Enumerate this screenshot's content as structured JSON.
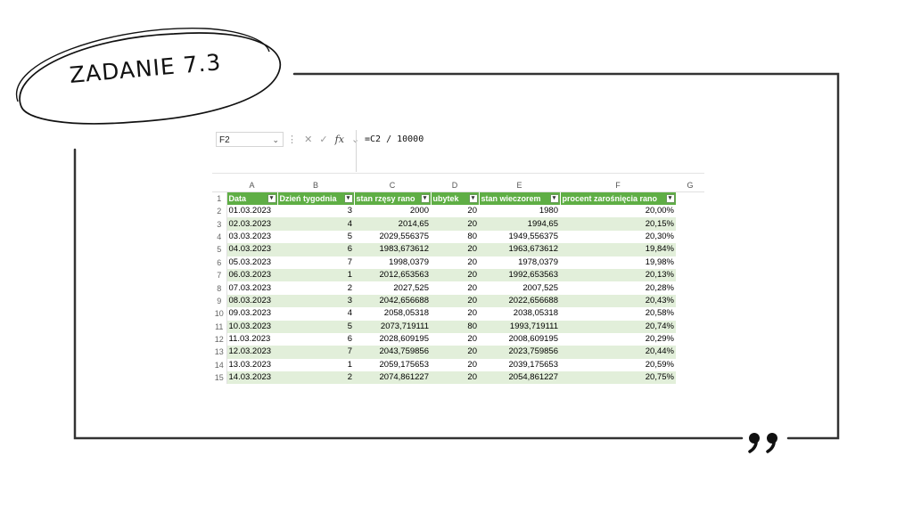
{
  "title": "ZADANIE 7.3",
  "colors": {
    "header_fill": "#5fae45",
    "band_fill": "#e2efda",
    "frame": "#333333"
  },
  "decoration": {
    "quote_icon": "closing-quote-icon",
    "glyph": "99"
  },
  "spreadsheet": {
    "name_box": "F2",
    "fx_label": "fx",
    "formula": "=C2 / 10000",
    "column_letters": [
      "A",
      "B",
      "C",
      "D",
      "E",
      "F",
      "G"
    ],
    "headers": [
      "Data",
      "Dzień tygodnia",
      "stan rzęsy rano",
      "ubytek",
      "stan wieczorem",
      "procent zarośnięcia rano"
    ],
    "rows": [
      {
        "n": "2",
        "a": "01.03.2023",
        "b": "3",
        "c": "2000",
        "d": "20",
        "e": "1980",
        "f": "20,00%"
      },
      {
        "n": "3",
        "a": "02.03.2023",
        "b": "4",
        "c": "2014,65",
        "d": "20",
        "e": "1994,65",
        "f": "20,15%"
      },
      {
        "n": "4",
        "a": "03.03.2023",
        "b": "5",
        "c": "2029,556375",
        "d": "80",
        "e": "1949,556375",
        "f": "20,30%"
      },
      {
        "n": "5",
        "a": "04.03.2023",
        "b": "6",
        "c": "1983,673612",
        "d": "20",
        "e": "1963,673612",
        "f": "19,84%"
      },
      {
        "n": "6",
        "a": "05.03.2023",
        "b": "7",
        "c": "1998,0379",
        "d": "20",
        "e": "1978,0379",
        "f": "19,98%"
      },
      {
        "n": "7",
        "a": "06.03.2023",
        "b": "1",
        "c": "2012,653563",
        "d": "20",
        "e": "1992,653563",
        "f": "20,13%"
      },
      {
        "n": "8",
        "a": "07.03.2023",
        "b": "2",
        "c": "2027,525",
        "d": "20",
        "e": "2007,525",
        "f": "20,28%"
      },
      {
        "n": "9",
        "a": "08.03.2023",
        "b": "3",
        "c": "2042,656688",
        "d": "20",
        "e": "2022,656688",
        "f": "20,43%"
      },
      {
        "n": "10",
        "a": "09.03.2023",
        "b": "4",
        "c": "2058,05318",
        "d": "20",
        "e": "2038,05318",
        "f": "20,58%"
      },
      {
        "n": "11",
        "a": "10.03.2023",
        "b": "5",
        "c": "2073,719111",
        "d": "80",
        "e": "1993,719111",
        "f": "20,74%"
      },
      {
        "n": "12",
        "a": "11.03.2023",
        "b": "6",
        "c": "2028,609195",
        "d": "20",
        "e": "2008,609195",
        "f": "20,29%"
      },
      {
        "n": "13",
        "a": "12.03.2023",
        "b": "7",
        "c": "2043,759856",
        "d": "20",
        "e": "2023,759856",
        "f": "20,44%"
      },
      {
        "n": "14",
        "a": "13.03.2023",
        "b": "1",
        "c": "2059,175653",
        "d": "20",
        "e": "2039,175653",
        "f": "20,59%"
      },
      {
        "n": "15",
        "a": "14.03.2023",
        "b": "2",
        "c": "2074,861227",
        "d": "20",
        "e": "2054,861227",
        "f": "20,75%"
      }
    ]
  }
}
